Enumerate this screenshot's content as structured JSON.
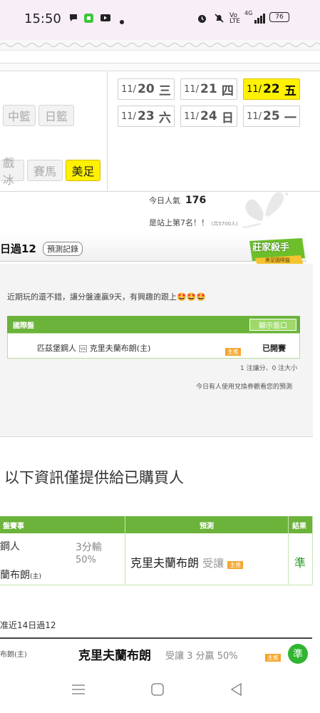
{
  "status": {
    "time": "15:50",
    "battery": "76",
    "left_icons": [
      "chat-bubble-icon",
      "app-notification-icon",
      "youtube-icon",
      "dot-icon"
    ],
    "right_icons": [
      "alarm-icon",
      "mute-icon",
      "volte-icon",
      "signal-icon",
      "battery-icon"
    ],
    "network": "4G"
  },
  "dates": {
    "row1": [
      {
        "md": "11/",
        "d": "20",
        "wd": "三"
      },
      {
        "md": "11/",
        "d": "21",
        "wd": "四"
      },
      {
        "md": "11/",
        "d": "22",
        "wd": "五"
      }
    ],
    "row2": [
      {
        "md": "11/",
        "d": "23",
        "wd": "六"
      },
      {
        "md": "11/",
        "d": "24",
        "wd": "日"
      },
      {
        "md": "11/",
        "d": "25",
        "wd": "一"
      }
    ],
    "active": "11/22"
  },
  "sports": {
    "row1": [
      "中籃",
      "日籃"
    ],
    "row2": [
      "戲冰",
      "賽馬",
      "美足"
    ],
    "active": "美足"
  },
  "stats": {
    "popularity_label": "今日人氣",
    "popularity_value": "176",
    "rank_text": "是站上第7名！！",
    "rank_note": "(共5700人)"
  },
  "card": {
    "title": "日過12",
    "record_button": "預測記錄",
    "badge_title": "莊家殺手",
    "badge_sub": "美足國際盤",
    "comment": "近期玩的還不錯，讓分盤連贏9天，有興趣的跟上🤩🤩🤩",
    "table_header": "國際盤",
    "show_button": "顯示盤口",
    "team_away": "匹茲堡鋼人",
    "vs": "vs",
    "team_home": "克里夫蘭布朗(主)",
    "host_tag": "主推",
    "status": "已開賽",
    "note_counts": "1 注讓分、0 注大小",
    "note_coupon": "今日有人使用兌換券觀看您的預測"
  },
  "purchase": {
    "heading": "以下資訊僅提供給已購買人",
    "headers": [
      "盤賽事",
      "預測",
      "結果"
    ],
    "row": {
      "team1": "鋼人",
      "team2": "蘭布朗",
      "team2_tag": "(主)",
      "line1": "3分輸",
      "line2": "50%",
      "pick": "克里夫蘭布朗",
      "pick_suffix": "受讓",
      "tag": "主推",
      "result": "準"
    }
  },
  "recent": {
    "label": "准近14日過12",
    "row_team": "布朗(主)",
    "row_pick": "克里夫蘭布朗",
    "row_detail": "受讓 3 分贏 50%",
    "row_tag": "主推",
    "row_result": "準"
  },
  "navbar": {
    "icons": [
      "menu-icon",
      "home-icon",
      "back-icon"
    ]
  }
}
